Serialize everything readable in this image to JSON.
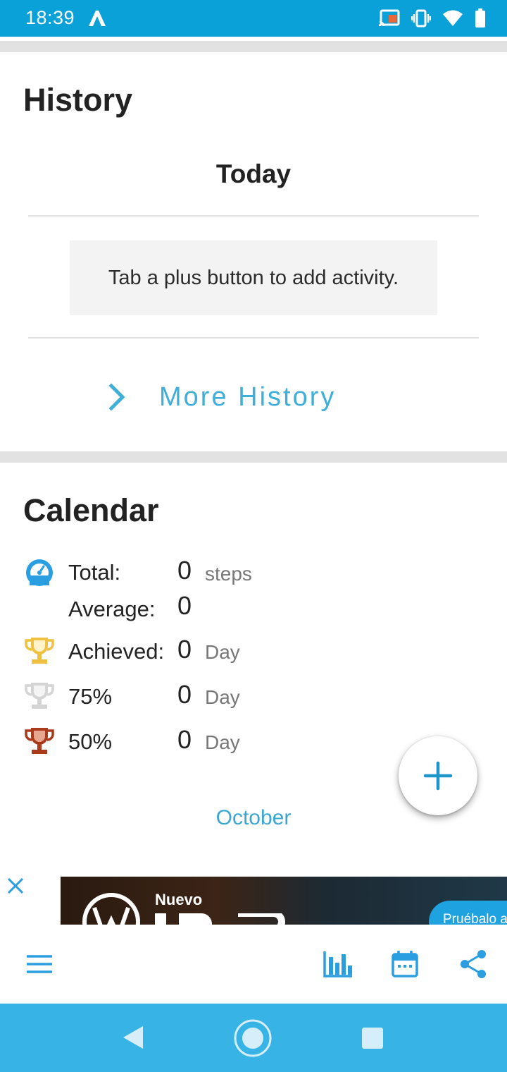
{
  "status_bar": {
    "time": "18:39",
    "icons": [
      "app-notification-icon",
      "cast-icon",
      "vibrate-icon",
      "wifi-icon",
      "battery-icon"
    ]
  },
  "history": {
    "title": "History",
    "today_label": "Today",
    "hint": "Tab a plus button to add activity.",
    "more_label": "More History"
  },
  "calendar": {
    "title": "Calendar",
    "stats": {
      "total": {
        "label": "Total:",
        "value": "0",
        "unit": "steps",
        "icon": "gauge-icon"
      },
      "average": {
        "label": "Average:",
        "value": "0"
      },
      "achieved": {
        "label": "Achieved:",
        "value": "0",
        "unit": "Day",
        "icon": "trophy-gold-icon"
      },
      "p75": {
        "label": "75%",
        "value": "0",
        "unit": "Day",
        "icon": "trophy-silver-icon"
      },
      "p50": {
        "label": "50%",
        "value": "0",
        "unit": "Day",
        "icon": "trophy-bronze-icon"
      }
    },
    "month": "October"
  },
  "ad": {
    "headline": "Nuevo",
    "cta": "Pruébalo a"
  },
  "toolbar": {
    "icons": [
      "menu-icon",
      "bar-chart-icon",
      "calendar-icon",
      "share-icon"
    ]
  },
  "colors": {
    "status_bar": "#0aa0d8",
    "accent": "#3fafd9",
    "nav_bar": "#37b3e6",
    "trophy_gold": "#f0c140",
    "trophy_silver": "#d4d4d4",
    "trophy_bronze": "#a93a1c"
  }
}
